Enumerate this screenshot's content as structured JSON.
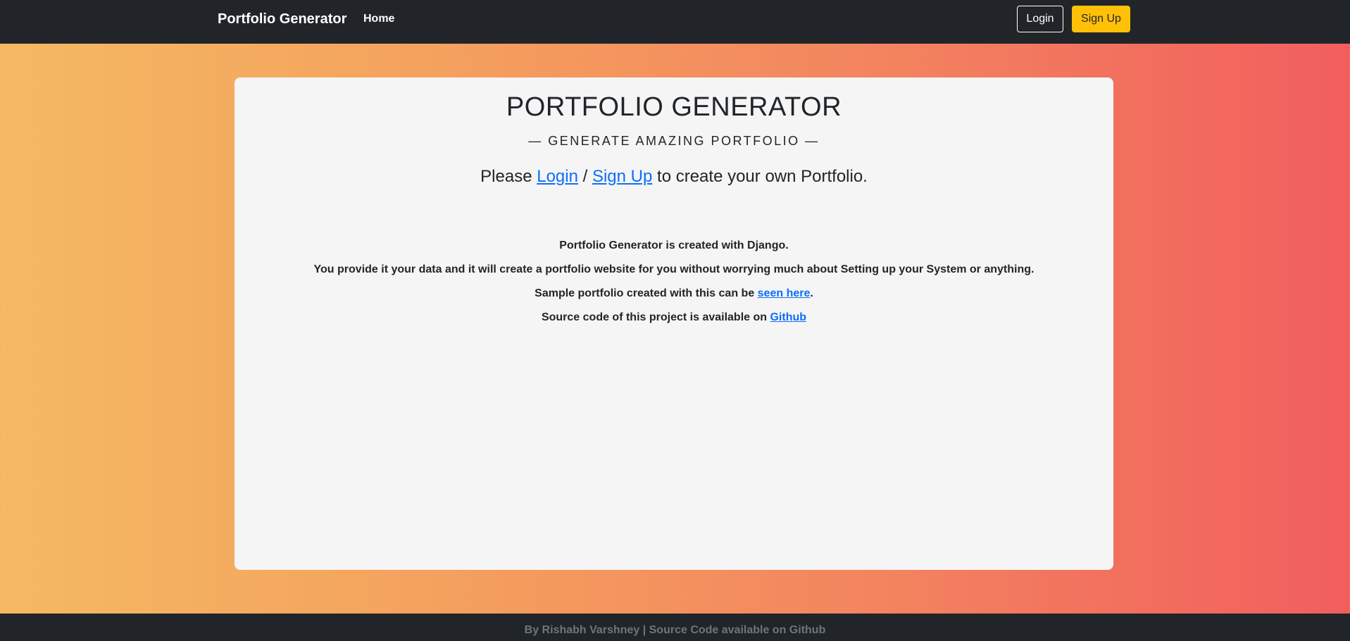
{
  "navbar": {
    "brand": "Portfolio Generator",
    "home_label": "Home",
    "login_label": "Login",
    "signup_label": "Sign Up"
  },
  "hero": {
    "title": "PORTFOLIO GENERATOR",
    "subtitle": "— GENERATE AMAZING PORTFOLIO —",
    "cta_prefix": "Please ",
    "cta_login": "Login",
    "cta_separator": " / ",
    "cta_signup": "Sign Up",
    "cta_suffix": " to create your own Portfolio."
  },
  "info": {
    "line1": "Portfolio Generator is created with Django.",
    "line2": "You provide it your data and it will create a portfolio website for you without worrying much about Setting up your System or anything.",
    "line3_prefix": "Sample portfolio created with this can be ",
    "line3_link": "seen here",
    "line3_suffix": ".",
    "line4_prefix": "Source code of this project is available on ",
    "line4_link": "Github"
  },
  "footer": {
    "text": "By Rishabh Varshney | Source Code available on Github"
  },
  "colors": {
    "navbar_bg": "#212529",
    "accent_yellow": "#ffc107",
    "link_blue": "#0d6efd",
    "card_bg": "#f5f5f5",
    "gradient_start": "#f4b962",
    "gradient_end": "#f15e5e"
  }
}
